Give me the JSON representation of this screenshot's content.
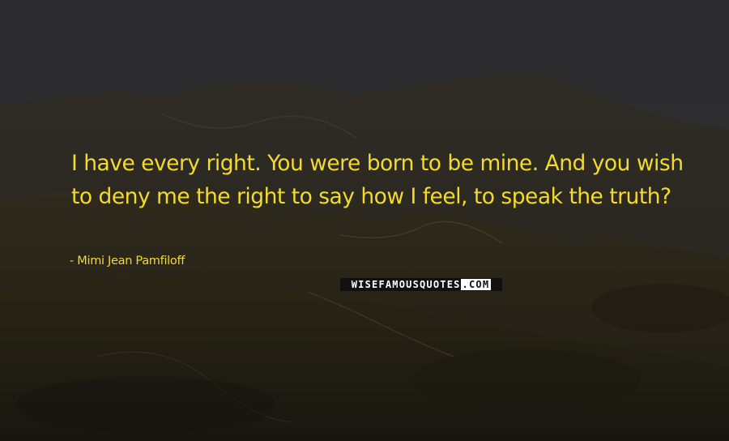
{
  "quote": {
    "text": "I have every right. You were born to be mine. And you wish to deny me the right to say how I feel, to speak the truth?",
    "author_prefix": "- ",
    "author": "Mimi Jean Pamfiloff"
  },
  "watermark": {
    "main": "WISEFAMOUSQUOTES",
    "tld": ".COM"
  },
  "colors": {
    "quote_text": "#f3da2c",
    "background_sky": "#2a2a2c",
    "background_hills": "#231f14"
  },
  "background": {
    "subject": "dark mountain ridge landscape at dusk"
  }
}
